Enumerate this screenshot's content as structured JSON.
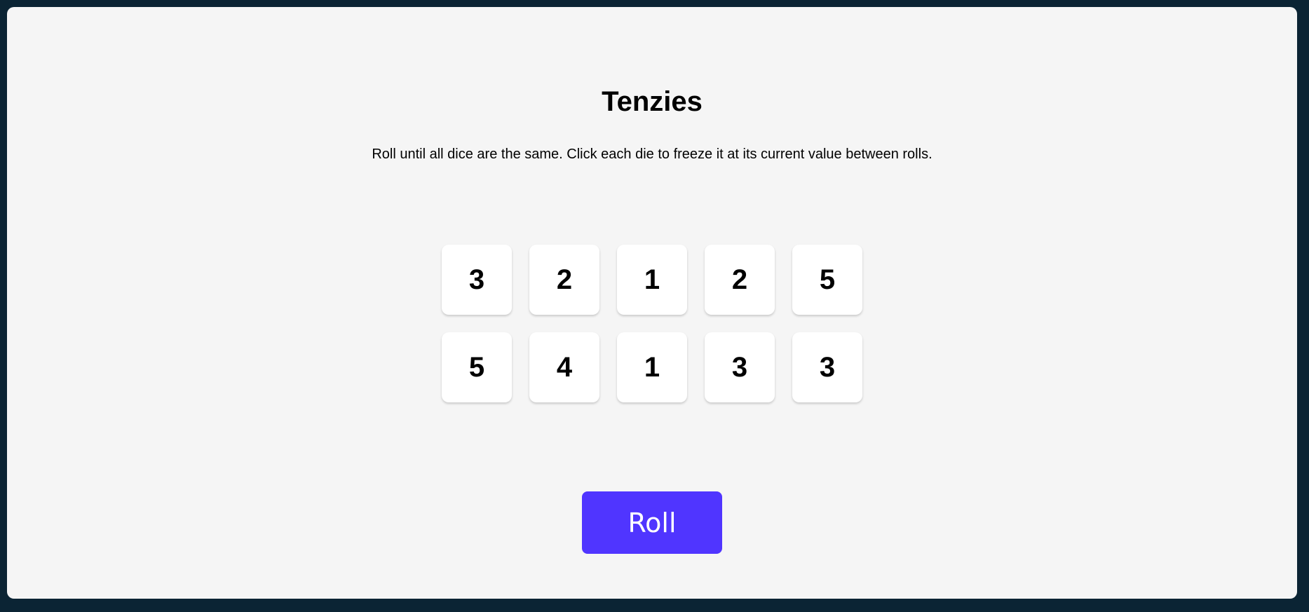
{
  "game": {
    "title": "Tenzies",
    "instructions": "Roll until all dice are the same. Click each die to freeze it at its current value between rolls.",
    "roll_label": "Roll"
  },
  "dice": [
    {
      "value": "3",
      "held": false
    },
    {
      "value": "2",
      "held": false
    },
    {
      "value": "1",
      "held": false
    },
    {
      "value": "2",
      "held": false
    },
    {
      "value": "5",
      "held": false
    },
    {
      "value": "5",
      "held": false
    },
    {
      "value": "4",
      "held": false
    },
    {
      "value": "1",
      "held": false
    },
    {
      "value": "3",
      "held": false
    },
    {
      "value": "3",
      "held": false
    }
  ],
  "colors": {
    "background": "#0b2434",
    "board": "#f5f5f5",
    "die": "#ffffff",
    "die_held": "#59e391",
    "accent": "#5035ff"
  }
}
